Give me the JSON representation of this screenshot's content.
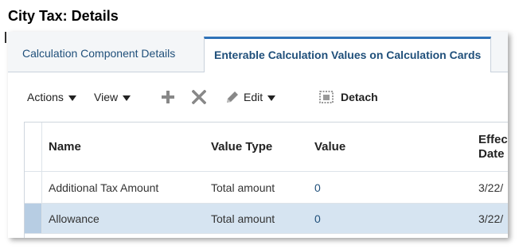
{
  "page": {
    "title": "City Tax: Details"
  },
  "tabs": [
    {
      "label": "Calculation Component Details",
      "active": false
    },
    {
      "label": "Enterable Calculation Values on Calculation Cards",
      "active": true
    }
  ],
  "toolbar": {
    "actions_label": "Actions",
    "view_label": "View",
    "add_icon": "plus-icon",
    "delete_icon": "x-icon",
    "edit_label": "Edit",
    "detach_label": "Detach"
  },
  "table": {
    "columns": [
      "Name",
      "Value Type",
      "Value",
      "Effec",
      "Date"
    ],
    "rows": [
      {
        "name": "Additional Tax Amount",
        "value_type": "Total amount",
        "value": "0",
        "date": "3/22/"
      },
      {
        "name": "Allowance",
        "value_type": "Total amount",
        "value": "0",
        "date": "3/22/"
      }
    ],
    "selected_row": 1
  },
  "colors": {
    "accent": "#2f72b8",
    "link": "#1f4f7a",
    "selected_row": "#d6e4f1"
  }
}
